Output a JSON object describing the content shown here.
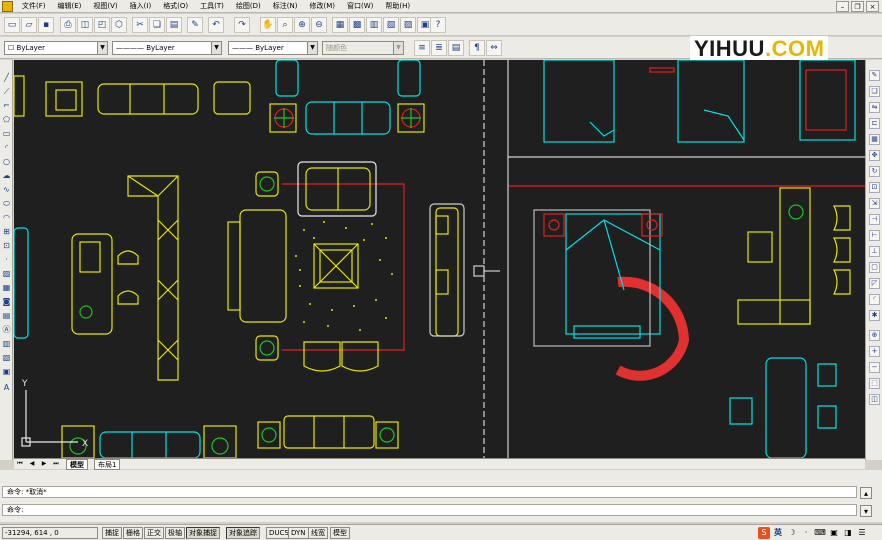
{
  "menu": [
    "文件(F)",
    "编辑(E)",
    "视图(V)",
    "插入(I)",
    "格式(O)",
    "工具(T)",
    "绘图(D)",
    "标注(N)",
    "修改(M)",
    "窗口(W)",
    "帮助(H)"
  ],
  "layers": {
    "layer": "ByLayer",
    "linetype": "ByLayer",
    "lineweight": "ByLayer",
    "plotstyle": "随颜色"
  },
  "watermark": {
    "prefix": "YIHUU",
    "suffix": ".COM"
  },
  "ucs": {
    "y": "Y",
    "x": "X"
  },
  "tabs": {
    "model": "模型",
    "layout": "布局1"
  },
  "command": {
    "history": "命令: *取消*",
    "prompt": "命令:"
  },
  "status": {
    "coords": "-31294, 614 , 0",
    "buttons": [
      "捕捉",
      "栅格",
      "正交",
      "极轴",
      "对象捕捉",
      "对象追踪",
      "DUCS",
      "DYN",
      "线宽",
      "模型"
    ]
  },
  "colors": {
    "canvas": "#1f1f1f",
    "cyan": "#00e0e0",
    "yellow": "#e6e600",
    "white": "#e8e8e8",
    "red": "#e02020",
    "green": "#20c020"
  }
}
